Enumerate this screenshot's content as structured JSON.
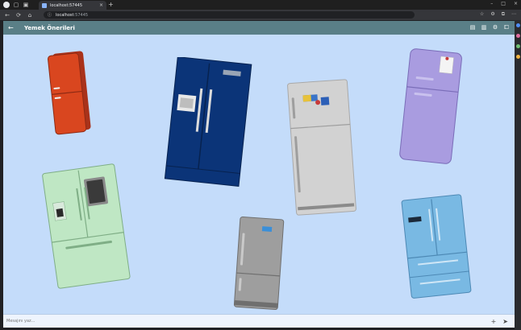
{
  "browser": {
    "tab_title": "localhost:57445",
    "tab_close": "×",
    "new_tab": "+",
    "url_host": "localhost",
    "url_port": ":57445",
    "info_glyph": "ⓘ",
    "window_controls": [
      "–",
      "□",
      "×"
    ],
    "nav_icons": [
      "←",
      "⟳",
      "⌂"
    ],
    "toolbar_icons": [
      "☆",
      "⚙",
      "⧉",
      "⋯"
    ]
  },
  "app": {
    "title": "Yemek Önerileri",
    "back_glyph": "←",
    "actions": [
      {
        "name": "chat-icon",
        "glyph": "▤"
      },
      {
        "name": "book-icon",
        "glyph": "▥"
      },
      {
        "name": "gear-icon",
        "glyph": "⚙"
      },
      {
        "name": "expand-icon",
        "glyph": "⧠"
      }
    ],
    "composer": {
      "placeholder": "Mesajını yaz...",
      "add_glyph": "+",
      "send_glyph": "➤"
    }
  },
  "colors": {
    "appbar": "#5a7f87",
    "background": "#c4dcfa",
    "red_fridge": "#d9461f",
    "navy_fridge": "#0b3478",
    "silver_fridge": "#d2d2d2",
    "purple_fridge": "#a99ce0",
    "green_fridge": "#bfe7c4",
    "gray_fridge": "#9e9e9e",
    "blue_fridge": "#79b9e3"
  }
}
